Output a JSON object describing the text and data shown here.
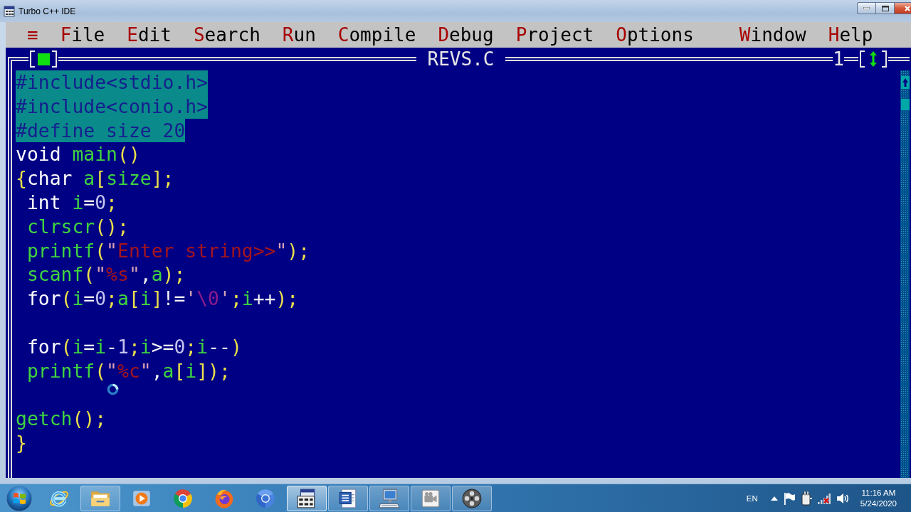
{
  "window": {
    "title": "Turbo C++ IDE"
  },
  "menu_bar": {
    "system_menu": "≡",
    "items": [
      {
        "hotkey": "F",
        "rest": "ile"
      },
      {
        "hotkey": "E",
        "rest": "dit"
      },
      {
        "hotkey": "S",
        "rest": "earch"
      },
      {
        "hotkey": "R",
        "rest": "un"
      },
      {
        "hotkey": "C",
        "rest": "ompile"
      },
      {
        "hotkey": "D",
        "rest": "ebug"
      },
      {
        "hotkey": "P",
        "rest": "roject"
      },
      {
        "hotkey": "O",
        "rest": "ptions"
      },
      {
        "hotkey": "W",
        "rest": "indow"
      },
      {
        "hotkey": "H",
        "rest": "elp"
      }
    ]
  },
  "editor": {
    "title": "REVS.C",
    "window_number": "1",
    "lines": [
      {
        "kind": "code",
        "selected": true,
        "indented": false,
        "tokens": [
          {
            "kind": "pre",
            "text": "#include<stdio.h>"
          }
        ]
      },
      {
        "kind": "code",
        "selected": true,
        "indented": false,
        "tokens": [
          {
            "kind": "pre",
            "text": "#include<conio.h>"
          }
        ]
      },
      {
        "kind": "code",
        "selected": true,
        "indented": false,
        "tokens": [
          {
            "kind": "pre",
            "text": "#define size 20"
          }
        ]
      },
      {
        "kind": "code",
        "selected": false,
        "indented": false,
        "tokens": [
          {
            "kind": "kw",
            "text": "void "
          },
          {
            "kind": "id",
            "text": "main"
          },
          {
            "kind": "punc",
            "text": "()"
          }
        ]
      },
      {
        "kind": "code",
        "selected": false,
        "indented": false,
        "tokens": [
          {
            "kind": "punc",
            "text": "{"
          },
          {
            "kind": "kw",
            "text": "char "
          },
          {
            "kind": "id",
            "text": "a"
          },
          {
            "kind": "punc",
            "text": "["
          },
          {
            "kind": "id",
            "text": "size"
          },
          {
            "kind": "punc",
            "text": "];"
          }
        ]
      },
      {
        "kind": "code",
        "selected": false,
        "indented": true,
        "tokens": [
          {
            "kind": "kw",
            "text": "int "
          },
          {
            "kind": "id",
            "text": "i"
          },
          {
            "kind": "op",
            "text": "="
          },
          {
            "kind": "num",
            "text": "0"
          },
          {
            "kind": "punc",
            "text": ";"
          }
        ]
      },
      {
        "kind": "code",
        "selected": false,
        "indented": true,
        "tokens": [
          {
            "kind": "id",
            "text": "clrscr"
          },
          {
            "kind": "punc",
            "text": "();"
          }
        ]
      },
      {
        "kind": "code",
        "selected": false,
        "indented": true,
        "tokens": [
          {
            "kind": "id",
            "text": "printf"
          },
          {
            "kind": "punc",
            "text": "("
          },
          {
            "kind": "quote",
            "text": "\""
          },
          {
            "kind": "str",
            "text": "Enter string>>"
          },
          {
            "kind": "quote",
            "text": "\""
          },
          {
            "kind": "punc",
            "text": ");"
          }
        ]
      },
      {
        "kind": "code",
        "selected": false,
        "indented": true,
        "tokens": [
          {
            "kind": "id",
            "text": "scanf"
          },
          {
            "kind": "punc",
            "text": "("
          },
          {
            "kind": "quote",
            "text": "\""
          },
          {
            "kind": "str",
            "text": "%s"
          },
          {
            "kind": "quote",
            "text": "\""
          },
          {
            "kind": "op",
            "text": ","
          },
          {
            "kind": "id",
            "text": "a"
          },
          {
            "kind": "punc",
            "text": ");"
          }
        ]
      },
      {
        "kind": "code",
        "selected": false,
        "indented": true,
        "tokens": [
          {
            "kind": "kw",
            "text": "for"
          },
          {
            "kind": "punc",
            "text": "("
          },
          {
            "kind": "id",
            "text": "i"
          },
          {
            "kind": "op",
            "text": "="
          },
          {
            "kind": "num",
            "text": "0"
          },
          {
            "kind": "punc",
            "text": ";"
          },
          {
            "kind": "id",
            "text": "a"
          },
          {
            "kind": "punc",
            "text": "["
          },
          {
            "kind": "id",
            "text": "i"
          },
          {
            "kind": "punc",
            "text": "]"
          },
          {
            "kind": "op",
            "text": "!="
          },
          {
            "kind": "quote",
            "text": "'"
          },
          {
            "kind": "esc",
            "text": "\\0"
          },
          {
            "kind": "quote",
            "text": "'"
          },
          {
            "kind": "punc",
            "text": ";"
          },
          {
            "kind": "id",
            "text": "i"
          },
          {
            "kind": "op",
            "text": "++"
          },
          {
            "kind": "punc",
            "text": ");"
          }
        ]
      },
      {
        "kind": "blank"
      },
      {
        "kind": "code",
        "selected": false,
        "indented": true,
        "tokens": [
          {
            "kind": "kw",
            "text": "for"
          },
          {
            "kind": "punc",
            "text": "("
          },
          {
            "kind": "id",
            "text": "i"
          },
          {
            "kind": "op",
            "text": "="
          },
          {
            "kind": "id",
            "text": "i"
          },
          {
            "kind": "op",
            "text": "-"
          },
          {
            "kind": "num",
            "text": "1"
          },
          {
            "kind": "punc",
            "text": ";"
          },
          {
            "kind": "id",
            "text": "i"
          },
          {
            "kind": "op",
            "text": ">="
          },
          {
            "kind": "num",
            "text": "0"
          },
          {
            "kind": "punc",
            "text": ";"
          },
          {
            "kind": "id",
            "text": "i"
          },
          {
            "kind": "op",
            "text": "--"
          },
          {
            "kind": "punc",
            "text": ")"
          }
        ]
      },
      {
        "kind": "code",
        "selected": false,
        "indented": true,
        "tokens": [
          {
            "kind": "id",
            "text": "printf"
          },
          {
            "kind": "punc",
            "text": "("
          },
          {
            "kind": "quote",
            "text": "\""
          },
          {
            "kind": "str",
            "text": "%c"
          },
          {
            "kind": "quote",
            "text": "\""
          },
          {
            "kind": "op",
            "text": ","
          },
          {
            "kind": "id",
            "text": "a"
          },
          {
            "kind": "punc",
            "text": "["
          },
          {
            "kind": "id",
            "text": "i"
          },
          {
            "kind": "punc",
            "text": "]);"
          }
        ]
      },
      {
        "kind": "blank"
      },
      {
        "kind": "code",
        "selected": false,
        "indented": false,
        "tokens": [
          {
            "kind": "id",
            "text": "getch"
          },
          {
            "kind": "punc",
            "text": "();"
          }
        ]
      },
      {
        "kind": "code",
        "selected": false,
        "indented": false,
        "tokens": [
          {
            "kind": "punc",
            "text": "}"
          }
        ]
      }
    ]
  },
  "taskbar": {
    "apps": [
      {
        "kind": "e-logo",
        "running": false,
        "selected": false
      },
      {
        "kind": "folder",
        "running": true,
        "selected": false
      },
      {
        "kind": "play",
        "running": false,
        "selected": false
      },
      {
        "kind": "tricolor-ring",
        "running": false,
        "selected": false
      },
      {
        "kind": "flame-globe",
        "running": false,
        "selected": false
      },
      {
        "kind": "blue-ring",
        "running": false,
        "selected": false
      },
      {
        "kind": "grid-window",
        "running": true,
        "selected": true
      },
      {
        "kind": "document",
        "running": true,
        "selected": false
      },
      {
        "kind": "monitor-keyboard",
        "running": true,
        "selected": false
      },
      {
        "kind": "camera",
        "running": true,
        "selected": false
      },
      {
        "kind": "reel",
        "running": true,
        "selected": false
      }
    ]
  },
  "tray": {
    "language": "EN",
    "network": {
      "connected": false
    },
    "time": "11:16 AM",
    "date": "5/24/2020"
  }
}
